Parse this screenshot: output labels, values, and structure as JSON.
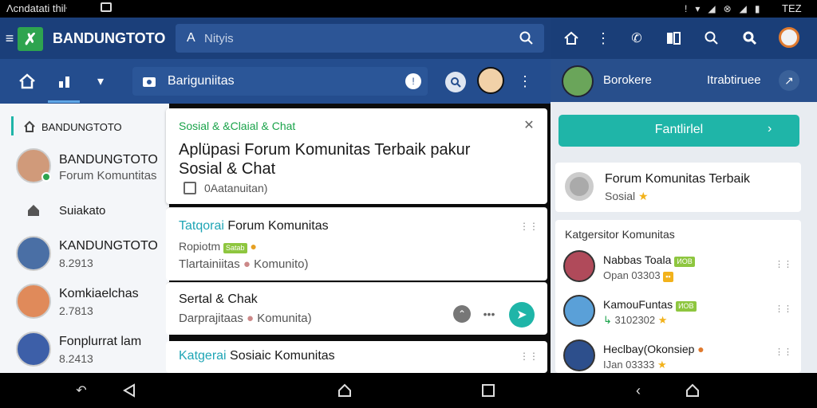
{
  "statusbar": {
    "left_text": "Ʌcndatati thiŀ",
    "time": "TEZ"
  },
  "header": {
    "brand": "BANDUNGTOTO",
    "search_prefix": "A",
    "search_placeholder": "Nityis"
  },
  "subheader": {
    "title": "Bariguniitas"
  },
  "left_sidebar": {
    "heading": "BANDUNGTOTO",
    "items": [
      {
        "title": "BANDUNGTOTO",
        "subtitle": "Forum Komuntitas"
      },
      {
        "title": "Suiakato",
        "subtitle": ""
      },
      {
        "title": "KANDUNGTOTO",
        "subtitle": "8.2913"
      },
      {
        "title": "Komkiaelchas",
        "subtitle": "2.7813"
      },
      {
        "title": "Fonplurrat lam",
        "subtitle": "8.2413"
      }
    ]
  },
  "main": {
    "card1": {
      "tag": "Sosial & &Claial & Chat",
      "title": "Aplüpasi Forum Komunitas Terbaik pakur Sosial & Chat",
      "meta": "0Aatanuitan)"
    },
    "card2": {
      "title_prefix": "Tatqorai",
      "title_rest": "Forum Komunitas",
      "line1_a": "Ropiotm",
      "line1_b": "Satab",
      "line2": "Tlartainiitas",
      "line2_b": "Komunito)"
    },
    "card3": {
      "title": "Sertal & Chak",
      "line": "Darprajitaas",
      "line_b": "Komunita)"
    },
    "card4": {
      "title_prefix": "Katgerai",
      "title_rest": "Sosiaic Komunitas"
    }
  },
  "right_panel": {
    "user": {
      "name": "Borokere",
      "label": "Itrabtiruee"
    },
    "cta_button": "Fantlirlel",
    "feature_card": {
      "title": "Forum Komunitas Terbaik",
      "subtitle": "Sosial"
    },
    "list_heading": "Katgersitor Komunitas",
    "list": [
      {
        "name": "Nabbas Toala",
        "badge": "ИОВ",
        "meta": "Opan 03303"
      },
      {
        "name": "KamouFuntas",
        "badge": "ИОВ",
        "meta": "3102302"
      },
      {
        "name": "Heclbay(Okonsiep",
        "badge": "",
        "meta": "IJan 03333"
      }
    ]
  },
  "colors": {
    "topbar": "#1b3f7a",
    "accent": "#1fb5a8",
    "green": "#2ea44f"
  }
}
